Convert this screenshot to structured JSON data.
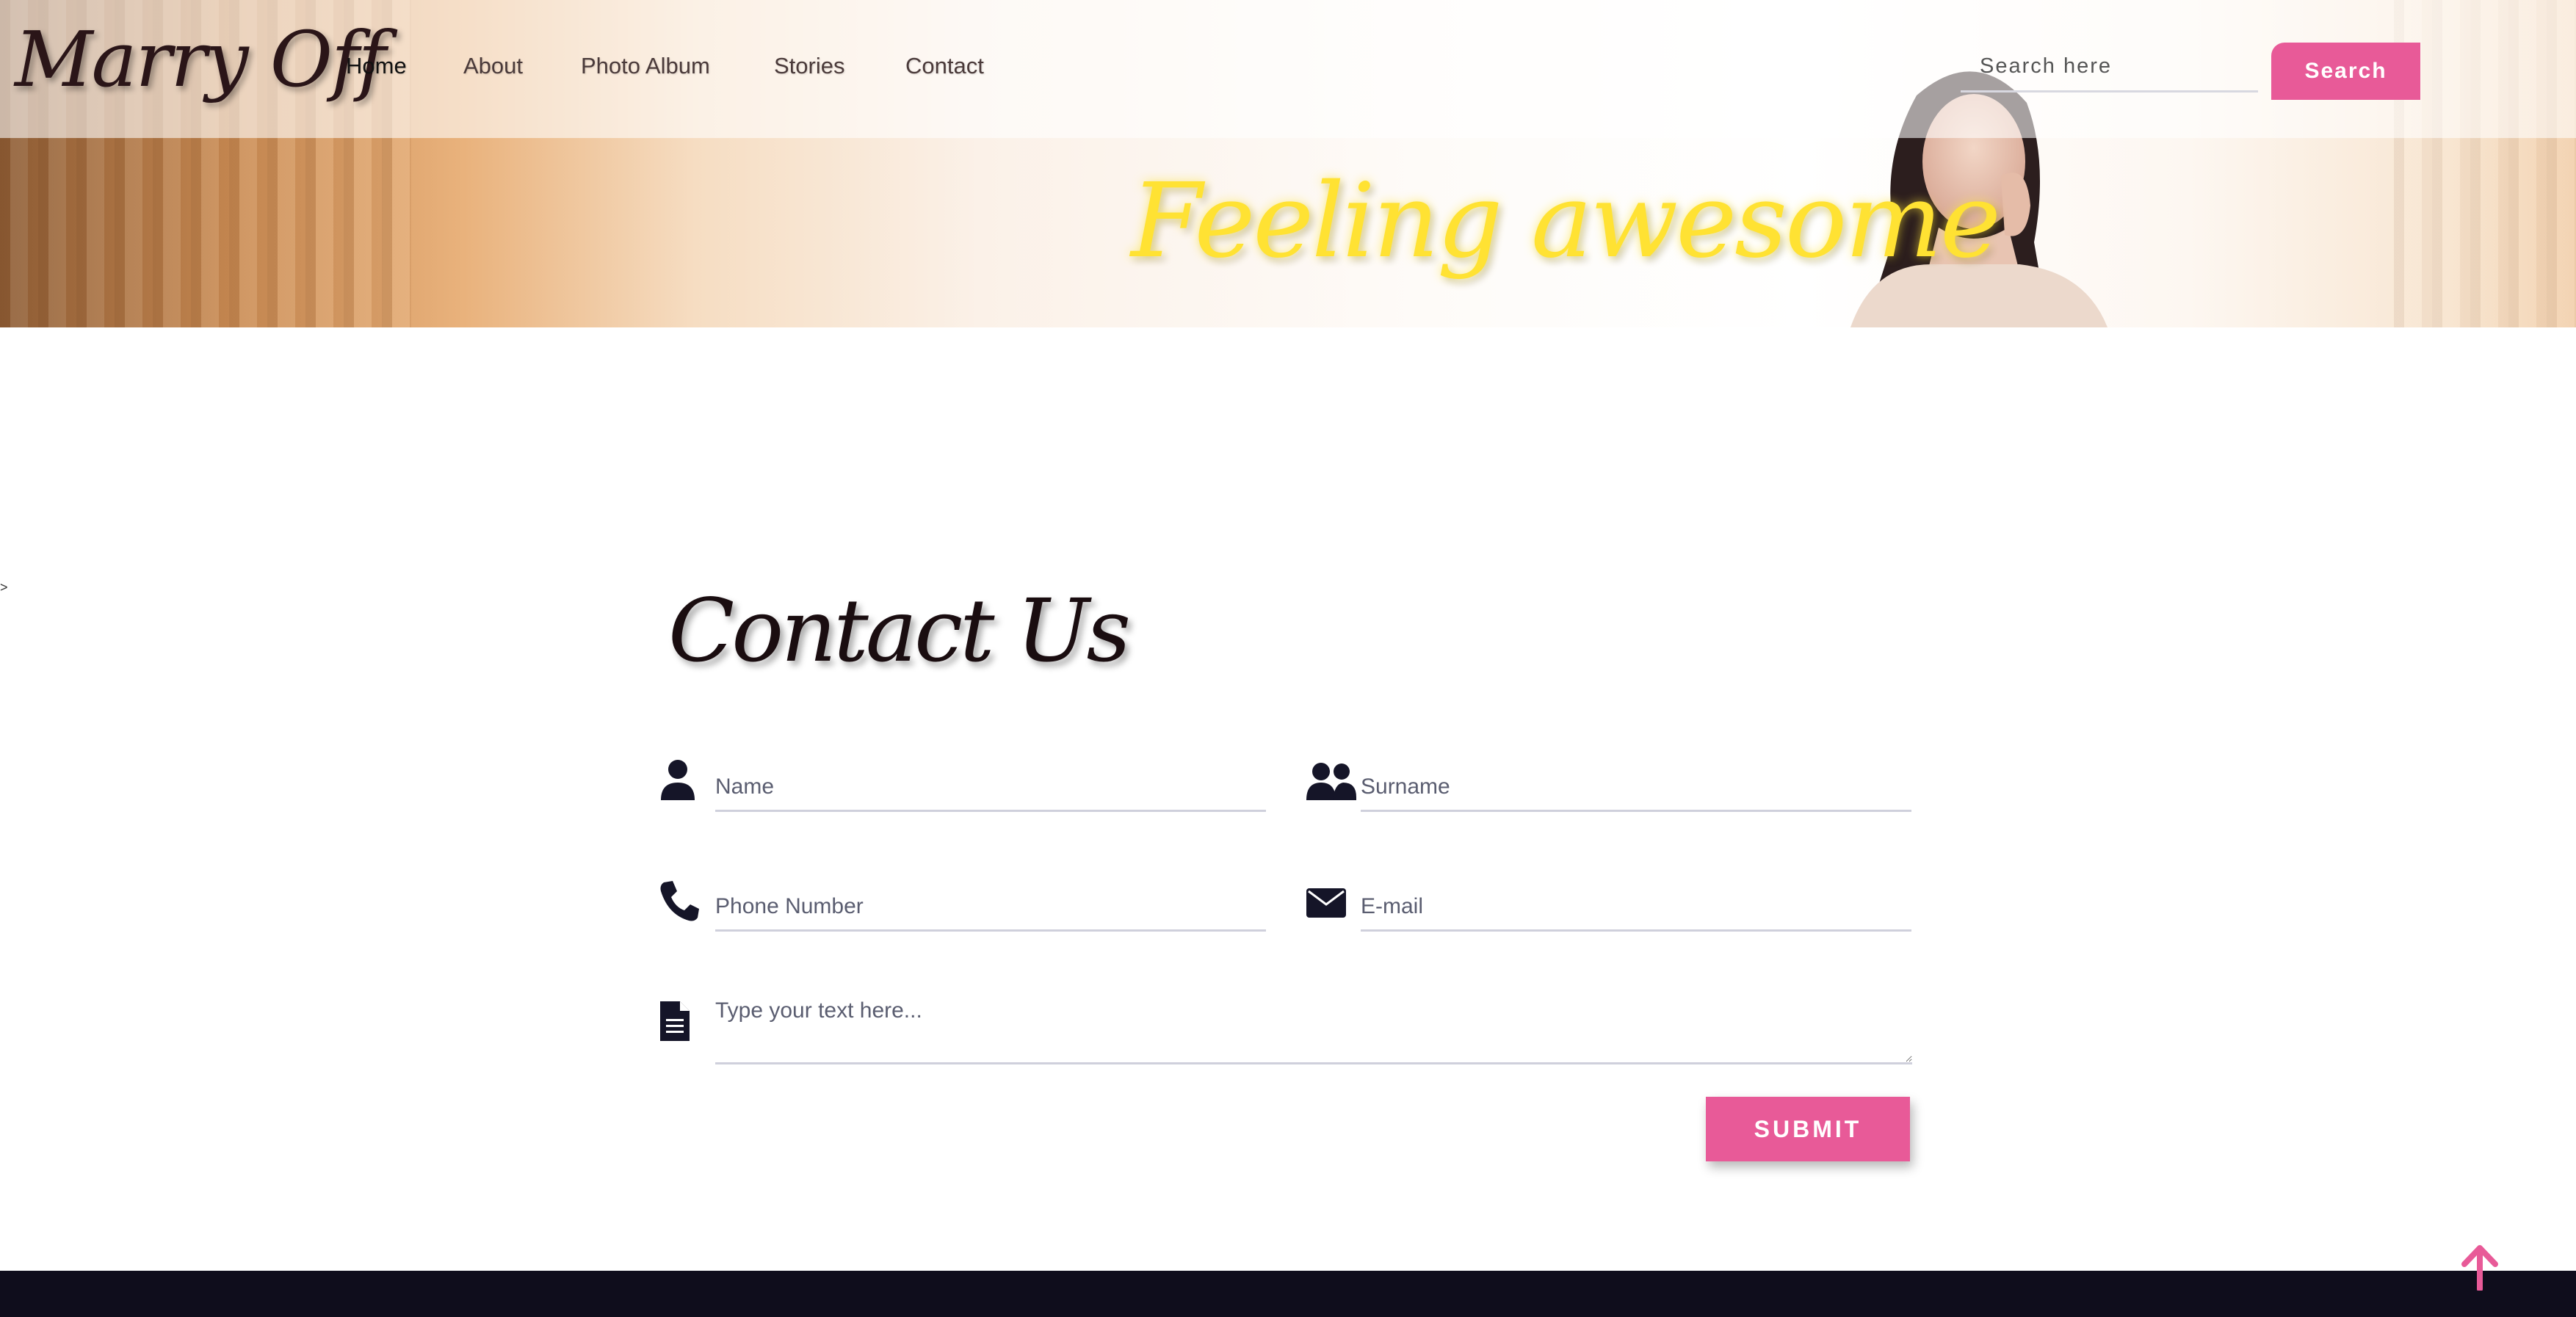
{
  "header": {
    "brand": "Marry Off",
    "nav": [
      {
        "label": "Home",
        "active": true
      },
      {
        "label": "About",
        "active": false
      },
      {
        "label": "Photo Album",
        "active": false
      },
      {
        "label": "Stories",
        "active": false
      },
      {
        "label": "Contact",
        "active": false
      }
    ],
    "search": {
      "placeholder": "Search here",
      "button_label": "Search"
    }
  },
  "hero": {
    "tagline": "Feeling awesome"
  },
  "stray_text": ">",
  "contact": {
    "title": "Contact Us",
    "fields": {
      "name": {
        "placeholder": "Name",
        "icon": "user-icon"
      },
      "surname": {
        "placeholder": "Surname",
        "icon": "users-icon"
      },
      "phone": {
        "placeholder": "Phone Number",
        "icon": "phone-icon"
      },
      "email": {
        "placeholder": "E-mail",
        "icon": "envelope-icon"
      },
      "message": {
        "placeholder": "Type your text here...",
        "icon": "document-icon"
      }
    },
    "submit_label": "SUBMIT"
  },
  "colors": {
    "accent": "#e85a98",
    "tagline": "#ffe233",
    "footer": "#0f0d1c",
    "icon": "#151528"
  },
  "scroll_top_icon": "arrow-up-icon"
}
